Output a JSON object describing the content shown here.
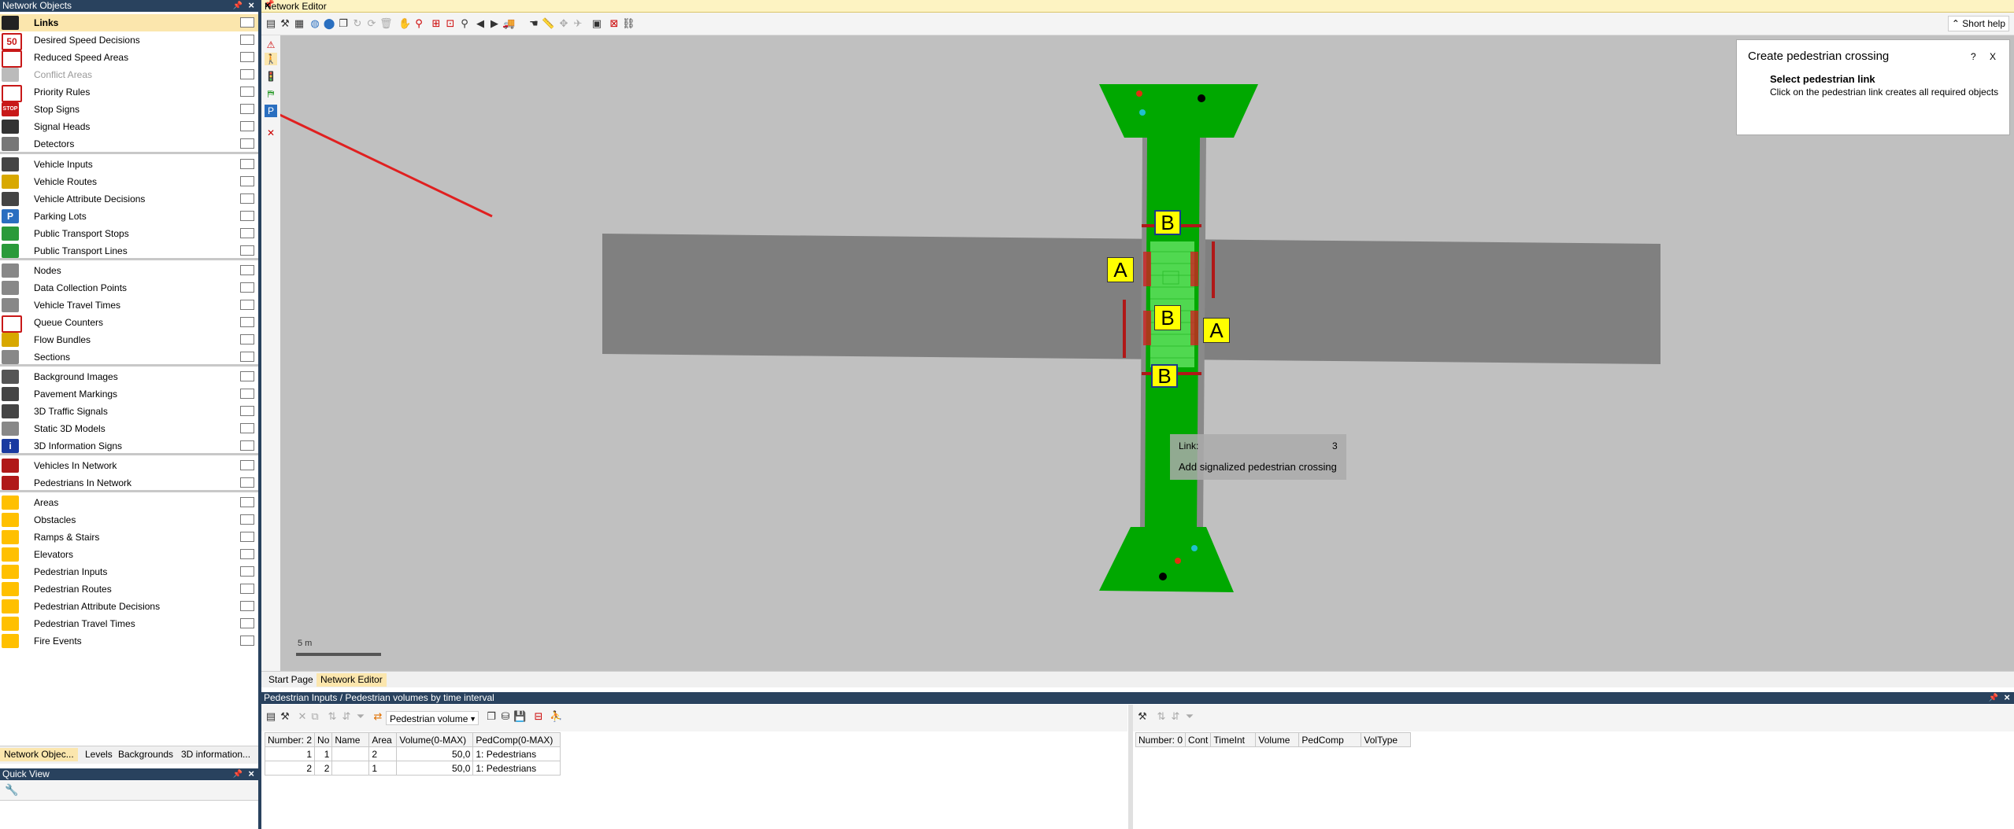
{
  "left_panel": {
    "title": "Network Objects",
    "items": [
      {
        "label": "Links",
        "icon": "link-icon"
      },
      {
        "label": "Desired Speed Decisions",
        "icon": "speed-sign-icon",
        "sign": "50"
      },
      {
        "label": "Reduced Speed Areas",
        "icon": "warning-triangle-icon"
      },
      {
        "label": "Conflict Areas",
        "icon": "conflict-area-icon"
      },
      {
        "label": "Priority Rules",
        "icon": "yield-sign-icon"
      },
      {
        "label": "Stop Signs",
        "icon": "stop-sign-icon",
        "sign": "STOP"
      },
      {
        "label": "Signal Heads",
        "icon": "traffic-light-icon"
      },
      {
        "label": "Detectors",
        "icon": "detector-icon"
      },
      {
        "label": "Vehicle Inputs",
        "icon": "vehicle-input-icon"
      },
      {
        "label": "Vehicle Routes",
        "icon": "vehicle-route-icon"
      },
      {
        "label": "Vehicle Attribute Decisions",
        "icon": "vehicle-attribute-icon"
      },
      {
        "label": "Parking Lots",
        "icon": "parking-icon",
        "sign": "P"
      },
      {
        "label": "Public Transport Stops",
        "icon": "bus-stop-icon"
      },
      {
        "label": "Public Transport Lines",
        "icon": "bus-line-icon"
      },
      {
        "label": "Nodes",
        "icon": "node-icon"
      },
      {
        "label": "Data Collection Points",
        "icon": "data-collection-icon"
      },
      {
        "label": "Vehicle Travel Times",
        "icon": "travel-time-icon"
      },
      {
        "label": "Queue Counters",
        "icon": "queue-counter-icon"
      },
      {
        "label": "Flow Bundles",
        "icon": "flow-bundle-icon"
      },
      {
        "label": "Sections",
        "icon": "section-icon"
      },
      {
        "label": "Background Images",
        "icon": "background-image-icon"
      },
      {
        "label": "Pavement Markings",
        "icon": "pavement-marking-icon"
      },
      {
        "label": "3D Traffic Signals",
        "icon": "traffic-signal-3d-icon"
      },
      {
        "label": "Static 3D Models",
        "icon": "static-model-icon"
      },
      {
        "label": "3D Information Signs",
        "icon": "info-sign-icon",
        "sign": "i"
      },
      {
        "label": "Vehicles In Network",
        "icon": "vehicles-in-network-icon"
      },
      {
        "label": "Pedestrians In Network",
        "icon": "pedestrians-in-network-icon"
      },
      {
        "label": "Areas",
        "icon": "area-icon"
      },
      {
        "label": "Obstacles",
        "icon": "obstacle-icon"
      },
      {
        "label": "Ramps & Stairs",
        "icon": "ramp-icon"
      },
      {
        "label": "Elevators",
        "icon": "elevator-icon"
      },
      {
        "label": "Pedestrian Inputs",
        "icon": "pedestrian-input-icon"
      },
      {
        "label": "Pedestrian Routes",
        "icon": "pedestrian-route-icon"
      },
      {
        "label": "Pedestrian Attribute Decisions",
        "icon": "pedestrian-attribute-icon"
      },
      {
        "label": "Pedestrian Travel Times",
        "icon": "pedestrian-travel-time-icon"
      },
      {
        "label": "Fire Events",
        "icon": "fire-icon"
      }
    ],
    "tabs": [
      "Network Objec...",
      "Levels",
      "Backgrounds",
      "3D information..."
    ],
    "quick_view_title": "Quick View"
  },
  "editor": {
    "title": "Network Editor",
    "short_help": "Short help",
    "scale_label": "5 m",
    "tabs": [
      "Start Page",
      "Network Editor"
    ],
    "help_card": {
      "title": "Create pedestrian crossing",
      "heading": "Select pedestrian link",
      "text": "Click on the pedestrian link creates all required objects",
      "help_btn": "?",
      "close_btn": "X"
    },
    "tooltip": {
      "label": "Link:",
      "value": "3",
      "action": "Add signalized pedestrian crossing"
    },
    "markers": [
      "B",
      "A",
      "B",
      "A",
      "B"
    ]
  },
  "list_panel": {
    "title": "Pedestrian Inputs / Pedestrian volumes by time interval",
    "dropdown": "Pedestrian volume",
    "left_table": {
      "headers": [
        "Number: 2",
        "No",
        "Name",
        "Area",
        "Volume(0-MAX)",
        "PedComp(0-MAX)"
      ],
      "rows": [
        [
          "1",
          "1",
          "",
          "2",
          "50,0",
          "1: Pedestrians"
        ],
        [
          "2",
          "2",
          "",
          "1",
          "50,0",
          "1: Pedestrians"
        ]
      ]
    },
    "right_table": {
      "headers": [
        "Number: 0",
        "Cont",
        "TimeInt",
        "Volume",
        "PedComp",
        "VolType"
      ]
    }
  },
  "colors": {
    "accent": "#29425e",
    "selection": "#fbe6ad",
    "road": "#808080",
    "grass": "#00a800",
    "marker": "#ffff00"
  }
}
